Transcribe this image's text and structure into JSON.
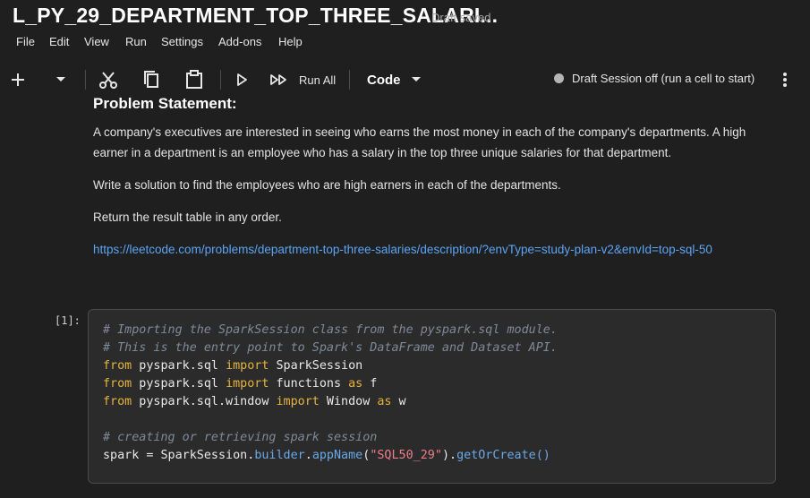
{
  "notebook": {
    "title": "L_PY_29_DEPARTMENT_TOP_THREE_SALARI...",
    "save_status": "Draft saved"
  },
  "menu": [
    "File",
    "Edit",
    "View",
    "Run",
    "Settings",
    "Add-ons",
    "Help"
  ],
  "toolbar": {
    "run_all_label": "Run All",
    "cell_type": "Code",
    "session_status": "Draft Session off (run a cell to start)",
    "icons": [
      "add-icon",
      "chevron-down-icon",
      "cut-icon",
      "copy-icon",
      "paste-icon",
      "run-icon",
      "run-all-icon",
      "more-vert-icon"
    ]
  },
  "markdown": {
    "heading": "Problem Statement:",
    "para1": "A company's executives are interested in seeing who earns the most money in each of the company's departments. A high earner in a department is an employee who has a salary in the top three unique salaries for that department.",
    "para2": "Write a solution to find the employees who are high earners in each of the departments.",
    "para3": "Return the result table in any order.",
    "link": "https://leetcode.com/problems/department-top-three-salaries/description/?envType=study-plan-v2&envId=top-sql-50"
  },
  "code_cell": {
    "prompt": "[1]:",
    "line1": "# Importing the SparkSession class from the pyspark.sql module.",
    "line2": "# This is the entry point to Spark's DataFrame and Dataset API.",
    "line3": {
      "k1": "from",
      "mod": " pyspark.sql ",
      "k2": "import",
      "name": " SparkSession"
    },
    "line4": {
      "k1": "from",
      "mod": " pyspark.sql ",
      "k2": "import",
      "name": " functions ",
      "k3": "as",
      "alias": " f"
    },
    "line5": {
      "k1": "from",
      "mod": " pyspark.sql.window ",
      "k2": "import",
      "name": " Window ",
      "k3": "as",
      "alias": " w"
    },
    "line7": "# creating or retrieving spark session",
    "line8": {
      "var": "spark = SparkSession.",
      "builder": "builder",
      "dot1": ".",
      "appName": "appName",
      "open": "(",
      "arg": "\"SQL50_29\"",
      "close": ").",
      "getOrCreate": "getOrCreate",
      "parens": "()"
    }
  }
}
